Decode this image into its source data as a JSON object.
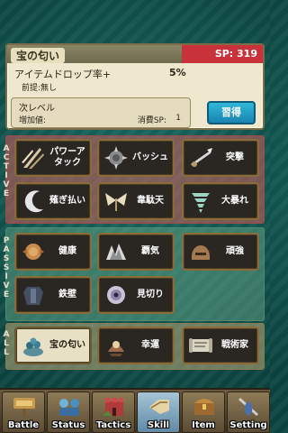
{
  "detail": {
    "skill_name": "宝の匂い",
    "sp": "SP: 319",
    "effect": "アイテムドロップ率+",
    "effect_value": "5%",
    "prereq": "前提:無し",
    "next_level_label": "次レベル",
    "increase_label": "増加値:",
    "cost_label": "消費SP:",
    "cost_value": "1",
    "learn_button": "習得"
  },
  "categories": {
    "active": "ACTIVE",
    "passive": "PASSIVE",
    "all": "ALL"
  },
  "skills": {
    "power_attack": "パワーア\nタック",
    "bash": "バッシュ",
    "charge": "突撃",
    "sweep": "薙ぎ払い",
    "idaten": "韋駄天",
    "rampage": "大暴れ",
    "health": "健康",
    "fighting_spirit": "覇気",
    "sturdy": "頑強",
    "iron_wall": "鉄壁",
    "insight": "見切り",
    "treasure_scent": "宝の匂い",
    "luck": "幸運",
    "tactician": "戦術家"
  },
  "tabs": [
    {
      "label": "Battle",
      "icon": "battle-sign-icon"
    },
    {
      "label": "Status",
      "icon": "party-icon"
    },
    {
      "label": "Tactics",
      "icon": "castle-icon"
    },
    {
      "label": "Skill",
      "icon": "skill-scroll-icon"
    },
    {
      "label": "Item",
      "icon": "treasure-chest-icon"
    },
    {
      "label": "Setting",
      "icon": "sword-shield-icon"
    }
  ],
  "colors": {
    "sp_bar": "#c8323a",
    "learn_button": "#2fb8d8",
    "active_band": "#d25a5a",
    "passive_band": "#6eaa8c",
    "all_band": "#beaa78"
  }
}
